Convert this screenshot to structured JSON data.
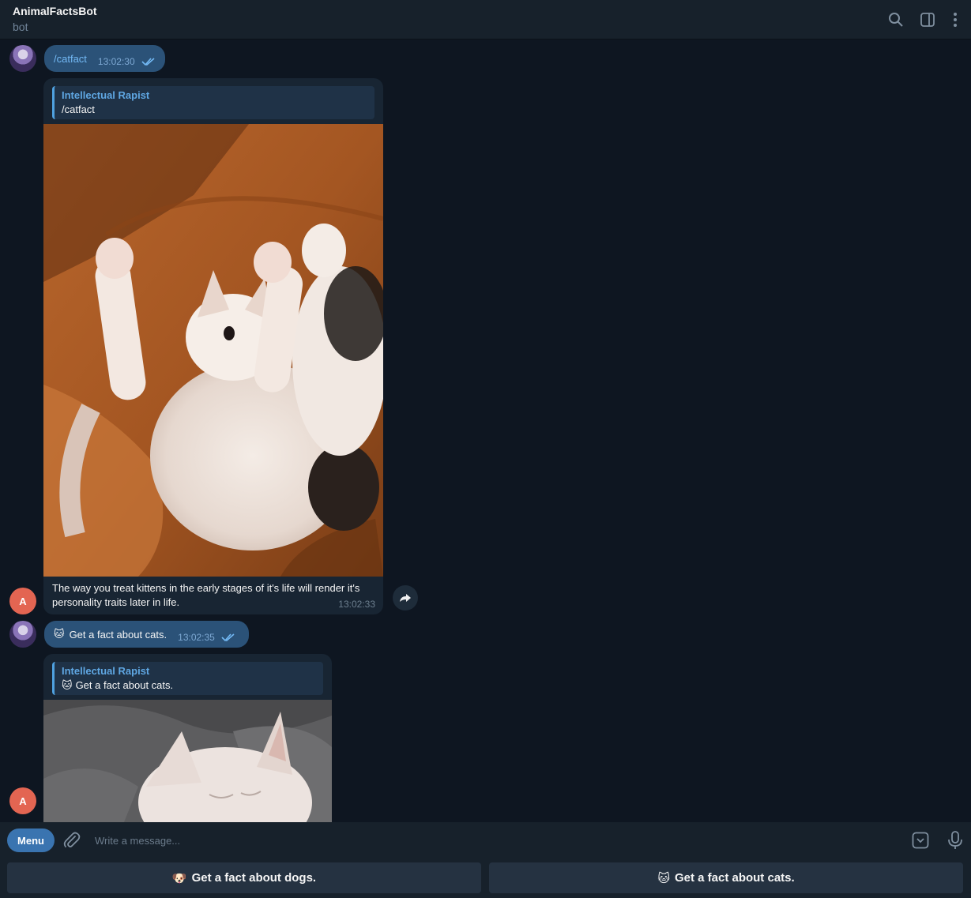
{
  "header": {
    "title": "AnimalFactsBot",
    "subtitle": "bot"
  },
  "messages": [
    {
      "kind": "outgoing",
      "text": "/catfact",
      "time": "13:02:30"
    },
    {
      "kind": "incoming",
      "reply_to": {
        "name": "Intellectual Rapist",
        "text": "/catfact"
      },
      "caption": "The way you treat kittens in the early stages of it's life will render it's personality traits later in life.",
      "time": "13:02:33",
      "avatar_letter": "A"
    },
    {
      "kind": "outgoing",
      "emoji": "🐱",
      "text": "Get a fact about cats.",
      "time": "13:02:35"
    },
    {
      "kind": "incoming",
      "reply_to": {
        "name": "Intellectual Rapist",
        "emoji": "🐱",
        "text": "Get a fact about cats."
      },
      "avatar_letter": "A"
    }
  ],
  "composer": {
    "menu_label": "Menu",
    "placeholder": "Write a message..."
  },
  "keyboard": {
    "buttons": [
      {
        "emoji": "🐶",
        "label": "Get a fact about dogs."
      },
      {
        "emoji": "🐱",
        "label": "Get a fact about cats."
      }
    ]
  },
  "colors": {
    "background": "#0e1621",
    "panel": "#17212b",
    "outgoing_bubble": "#2b5278",
    "incoming_bubble": "#182533",
    "accent": "#5fa7e3",
    "avatar_a": "#e36552"
  },
  "icons": {
    "header": [
      "search-icon",
      "sidebar-toggle-icon",
      "more-vertical-icon"
    ],
    "composer": [
      "paperclip-icon",
      "keyboard-toggle-icon",
      "microphone-icon"
    ],
    "message": [
      "double-check-icon",
      "forward-icon"
    ]
  }
}
